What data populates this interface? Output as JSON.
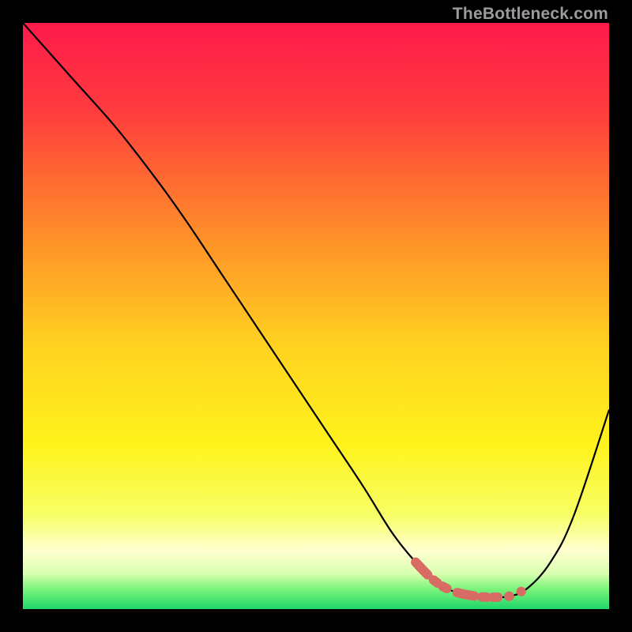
{
  "watermark": "TheBottleneck.com",
  "chart_data": {
    "type": "line",
    "title": "",
    "xlabel": "",
    "ylabel": "",
    "xlim": [
      0,
      100
    ],
    "ylim": [
      0,
      100
    ],
    "background_gradient": {
      "stops": [
        {
          "offset": 0.0,
          "color": "#ff1a4b"
        },
        {
          "offset": 0.15,
          "color": "#ff3c3e"
        },
        {
          "offset": 0.35,
          "color": "#ff8a2a"
        },
        {
          "offset": 0.55,
          "color": "#ffd220"
        },
        {
          "offset": 0.72,
          "color": "#fff31c"
        },
        {
          "offset": 0.84,
          "color": "#f7ff66"
        },
        {
          "offset": 0.9,
          "color": "#ffffd0"
        },
        {
          "offset": 0.94,
          "color": "#d8ffb0"
        },
        {
          "offset": 0.965,
          "color": "#7cf57c"
        },
        {
          "offset": 1.0,
          "color": "#1fd66a"
        }
      ]
    },
    "series": [
      {
        "name": "bottleneck-curve",
        "color": "#000000",
        "width": 2.2,
        "x": [
          0,
          8,
          16,
          23,
          28,
          34,
          40,
          46,
          52,
          58,
          63,
          67,
          70,
          73,
          76,
          79.5,
          83,
          86,
          90,
          94,
          100
        ],
        "y": [
          100,
          91,
          82,
          73,
          66,
          57,
          48,
          39,
          30,
          21,
          13,
          8,
          5,
          3.2,
          2.4,
          2.0,
          2.2,
          3.5,
          8,
          16,
          34
        ]
      }
    ],
    "highlight": {
      "name": "optimal-zone",
      "color": "#d86b64",
      "x": [
        67,
        70,
        73,
        76,
        79.5,
        83
      ],
      "y": [
        8,
        5,
        3.2,
        2.4,
        2.0,
        2.2
      ],
      "dot_end": {
        "x": 85,
        "y": 3.0
      }
    }
  }
}
